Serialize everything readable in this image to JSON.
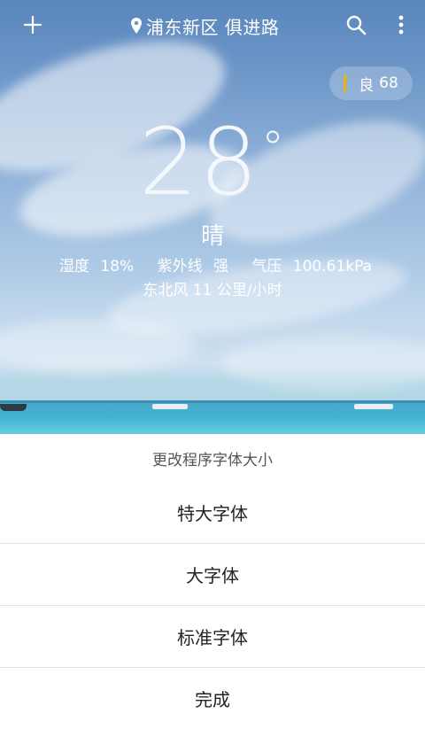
{
  "header": {
    "location": "浦东新区 俱进路",
    "add_icon": "plus-icon",
    "location_icon": "map-pin-icon",
    "search_icon": "search-icon",
    "menu_icon": "more-vertical-icon"
  },
  "aqi": {
    "level": "良",
    "value": "68",
    "accent_color": "#f0b400"
  },
  "weather": {
    "temperature": "28",
    "unit": "°",
    "condition": "晴",
    "humidity_label": "湿度",
    "humidity": "18%",
    "uv_label": "紫外线",
    "uv": "强",
    "pressure_label": "气压",
    "pressure": "100.61kPa",
    "wind": "东北风 11 公里/小时"
  },
  "font_sheet": {
    "title": "更改程序字体大小",
    "options": [
      "特大字体",
      "大字体",
      "标准字体",
      "完成"
    ]
  }
}
